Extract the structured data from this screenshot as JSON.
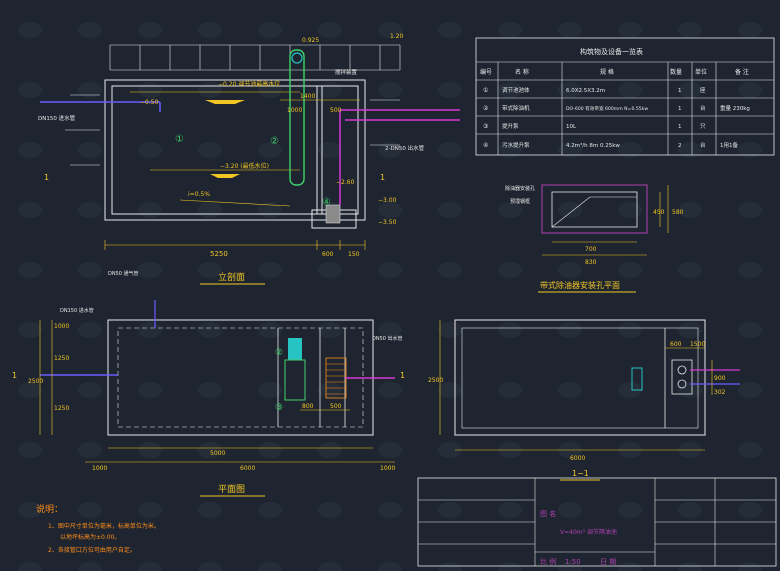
{
  "colors": {
    "background": "#1e2530",
    "wall": "#e8e8e8",
    "dimension": "#f3c623",
    "pipe_blue": "#6a5cff",
    "pipe_magenta": "#d53ad5",
    "equipment_green": "#3fd16b",
    "equipment_cyan": "#27c3c3",
    "note_orange": "#ff8c1a",
    "titleblock_magenta": "#b040b0"
  },
  "elevation": {
    "title": "立剖面",
    "top_level": "0.925",
    "level_high": "1.20",
    "water_high": "−0.20 调节池最高水位",
    "water_low": "−3.20 (最低水位)",
    "pipe_in": "DN150 进水管",
    "pipe_out": "2-DN50 出水管",
    "mixer_note": "搅拌装置",
    "slope": "i=0.5%",
    "level_bottom_1": "−3.00",
    "level_bottom_2": "−3.50",
    "level_pit": "−2.60",
    "level_side": "−0.50",
    "dim_total": "5250",
    "dim_pit": "600",
    "dim_wall": "150",
    "dim_top_1": "1400",
    "dim_top_2": "1000",
    "dim_top_3": "500",
    "label_1": "①",
    "label_2": "②",
    "label_4": "④",
    "section_mark": "1"
  },
  "plan": {
    "title": "平面图",
    "pipe_in": "DN150 进水管",
    "pipe_vent": "DN50 通气管",
    "pipe_out": "DN50 出水管",
    "dim_width": "2500",
    "dim_left_1": "1000",
    "dim_left_2": "1250",
    "dim_left_3": "1250",
    "dim_bottom_total": "6000",
    "dim_bottom_1": "5000",
    "dim_bottom_2": "1000",
    "dim_bottom_3": "1000",
    "dim_sub_1": "800",
    "dim_sub_2": "500",
    "label_2": "②",
    "label_3": "③",
    "section_mark": "1"
  },
  "section": {
    "title": "1−1",
    "dim_width": "2500",
    "dim_total": "6000",
    "dim_1": "600",
    "dim_2": "1500",
    "dim_v1": "900",
    "dim_v2": "302"
  },
  "hatch_detail": {
    "title": "带式除油器安装孔平面",
    "note_1": "除油器安装孔",
    "note_2": "预埋钢框",
    "dim_w1": "700",
    "dim_w2": "830",
    "dim_h1": "450",
    "dim_h2": "580"
  },
  "table": {
    "title": "构筑物及设备一览表",
    "headers": [
      "编号",
      "名 称",
      "规 格",
      "数量",
      "单位",
      "备 注"
    ],
    "rows": [
      [
        "①",
        "调节池池体",
        "6.0X2.5X3.2m",
        "1",
        "座",
        ""
      ],
      [
        "②",
        "带式除油机",
        "DO-600 有效带宽 600mm N=0.55kw",
        "1",
        "台",
        "重量 230kg"
      ],
      [
        "③",
        "提升泵",
        "10L",
        "1",
        "只",
        ""
      ],
      [
        "④",
        "污水提升泵",
        "4.2m³/h 8m 0.25kw",
        "2",
        "台",
        "1用1备"
      ]
    ]
  },
  "notes": {
    "heading": "说明：",
    "line_1": "1、图中尺寸单位为毫米，标高单位为米。",
    "line_1b": "以地坪标高为±0.00。",
    "line_2": "2、各接管口方位可由用户自定。"
  },
  "title_block": {
    "name_label": "图 名",
    "name_value": "V=40m³ 调节隔油池",
    "scale_label": "比 例",
    "scale_value": "1:50",
    "date_label": "日 期"
  }
}
